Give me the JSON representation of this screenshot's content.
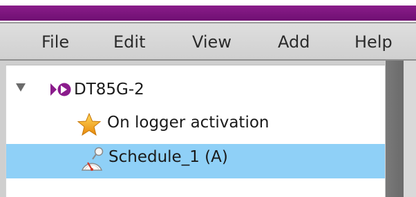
{
  "menu": {
    "file": "File",
    "edit": "Edit",
    "view": "View",
    "add": "Add",
    "help": "Help"
  },
  "tree": {
    "device": {
      "label": "DT85G-2",
      "icon": "dt-logo-icon",
      "expanded": true
    },
    "trigger": {
      "label": "On logger activation",
      "icon": "star-icon"
    },
    "schedule": {
      "label": "Schedule_1 (A)",
      "icon": "stopwatch-icon",
      "selected": true
    }
  },
  "colors": {
    "title_bar": "#7a1580",
    "selection": "#8fd0f7",
    "device_icon": "#8b1c8c",
    "star": "#f2a514"
  }
}
